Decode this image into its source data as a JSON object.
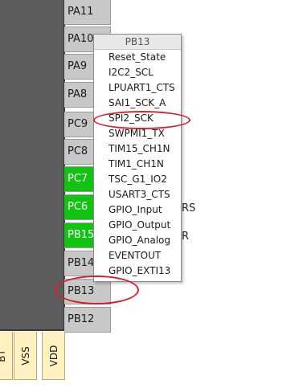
{
  "pins_right": [
    {
      "label": "PA11",
      "active": false
    },
    {
      "label": "PA10",
      "active": false
    },
    {
      "label": "PA9",
      "active": false
    },
    {
      "label": "PA8",
      "active": false
    },
    {
      "label": "PC9",
      "active": false
    },
    {
      "label": "PC8",
      "active": false
    },
    {
      "label": "PC7",
      "active": true
    },
    {
      "label": "PC6",
      "active": true
    },
    {
      "label": "PB15",
      "active": true
    },
    {
      "label": "PB14",
      "active": false
    },
    {
      "label": "PB13",
      "active": false
    },
    {
      "label": "PB12",
      "active": false
    }
  ],
  "pins_bottom": [
    {
      "label": "BT"
    },
    {
      "label": "VSS"
    },
    {
      "label": "VDD"
    }
  ],
  "side_labels": {
    "rs": "RS",
    "r": "R"
  },
  "context_menu": {
    "title": "PB13",
    "items": [
      "Reset_State",
      "I2C2_SCL",
      "LPUART1_CTS",
      "SAI1_SCK_A",
      "SPI2_SCK",
      "SWPMI1_TX",
      "TIM15_CH1N",
      "TIM1_CH1N",
      "TSC_G1_IO2",
      "USART3_CTS",
      "GPIO_Input",
      "GPIO_Output",
      "GPIO_Analog",
      "EVENTOUT",
      "GPIO_EXTI13"
    ]
  },
  "colors": {
    "active_pin": "#12c412",
    "inactive_pin": "#c8c8c8",
    "chip_body": "#5c5c5c",
    "highlight": "#d8202a",
    "power_pin": "#fff2c0"
  }
}
